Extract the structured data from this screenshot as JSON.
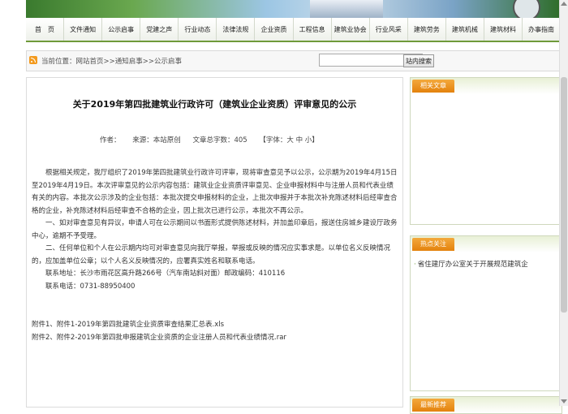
{
  "nav": {
    "items": [
      "首　页",
      "文件通知",
      "公示启事",
      "党建之声",
      "行业动态",
      "法律法规",
      "企业资质",
      "工程信息",
      "建筑业协会",
      "行业风采",
      "建筑劳务",
      "建筑机械",
      "建筑材料",
      "办事指南"
    ]
  },
  "location": {
    "text": "当前位置：网站首页>>通知启事>>公示启事",
    "search_placeholder": "",
    "search_button": "站内搜索"
  },
  "article": {
    "title": "关于2019年第四批建筑业行政许可（建筑业企业资质）评审意见的公示",
    "author_label": "作者：",
    "source_label": "来源：本站原创",
    "wordcount_label": "文章总字数：405",
    "font_size_label": "【字体：大 中 小】",
    "paragraphs": [
      "根据相关规定，我厅组织了2019年第四批建筑业行政许可评审，现将审查意见予以公示，公示期为2019年4月15日至2019年4月19日。本次评审意见的公示内容包括：建筑业企业资质评审意见、企业申报材料中与注册人员和代表业绩有关的内容。本批次公示涉及的企业包括：本批次提交申报材料的企业，上批次申报并于本批次补充陈述材料后经审查合格的企业，补充陈述材料后经审查不合格的企业，因上批次已进行公示，本批次不再公示。",
      "一、如对审查意见有异议，申请人可在公示期间以书面形式提供陈述材料，并加盖印章后，报送住房城乡建设厅政务中心，逾期不予受理。",
      "二、任何单位和个人在公示期内均可对审查意见向我厅举报，举报或反映的情况应实事求是。以单位名义反映情况的，应加盖单位公章；以个人名义反映情况的，应署真实姓名和联系电话。",
      "联系地址：长沙市雨花区高升路266号（汽车南站斜对面）邮政编码：410116",
      "联系电话：0731-88950400"
    ],
    "attachments": [
      "附件1、附件1-2019年第四批建筑企业资质审查结果汇总表.xls",
      "附件2、附件2-2019年第四批申报建筑企业资质的企业注册人员和代表业绩情况.rar"
    ]
  },
  "sidebar": {
    "related_title": "相关文章",
    "hot_title": "热点关注",
    "hot_items": [
      "省住建厅办公室关于开展规范建筑企"
    ],
    "latest_title": "最新推荐"
  }
}
